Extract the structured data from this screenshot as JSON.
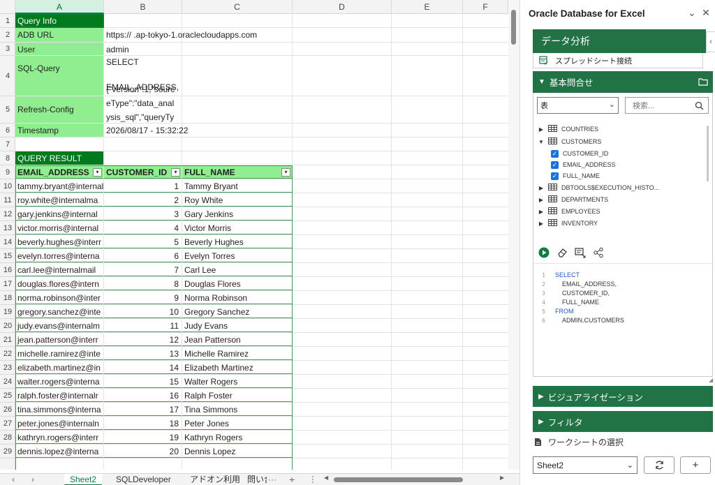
{
  "sheet": {
    "columns": [
      "A",
      "B",
      "C",
      "D",
      "E",
      "F"
    ],
    "rows": [
      "1",
      "2",
      "3",
      "4",
      "5",
      "6",
      "7",
      "8",
      "9",
      "10",
      "11",
      "12",
      "13",
      "14",
      "15",
      "16",
      "17",
      "18",
      "19",
      "20",
      "21",
      "22",
      "23",
      "24",
      "25",
      "26",
      "27",
      "28",
      "29"
    ],
    "info": {
      "title": "Query Info",
      "adb_url_label": "ADB URL",
      "adb_url_value": "https://                         .ap-tokyo-1.oraclecloudapps.com",
      "user_label": "User",
      "user_value": "admin",
      "sql_label": "SQL-Query",
      "sql_line1": "SELECT",
      "sql_line2": "EMAIL_ADDRESS,",
      "refresh_label": "Refresh-Config",
      "refresh_line1": "{\"version\":1,\"sourc",
      "refresh_line2": "eType\":\"data_anal",
      "refresh_line3": "ysis_sql\",\"queryTy",
      "timestamp_label": "Timestamp",
      "timestamp_value": "2026/08/17 - 15:32:22"
    },
    "result_title": "QUERY RESULT",
    "headers": [
      "EMAIL_ADDRESS",
      "CUSTOMER_ID",
      "FULL_NAME"
    ],
    "records": [
      {
        "email": "tammy.bryant@internal",
        "id": "1",
        "name": "Tammy Bryant"
      },
      {
        "email": "roy.white@internalma",
        "id": "2",
        "name": "Roy White"
      },
      {
        "email": "gary.jenkins@internal",
        "id": "3",
        "name": "Gary Jenkins"
      },
      {
        "email": "victor.morris@internal",
        "id": "4",
        "name": "Victor Morris"
      },
      {
        "email": "beverly.hughes@interr",
        "id": "5",
        "name": "Beverly Hughes"
      },
      {
        "email": "evelyn.torres@interna",
        "id": "6",
        "name": "Evelyn Torres"
      },
      {
        "email": "carl.lee@internalmail",
        "id": "7",
        "name": "Carl Lee"
      },
      {
        "email": "douglas.flores@intern",
        "id": "8",
        "name": "Douglas Flores"
      },
      {
        "email": "norma.robinson@inter",
        "id": "9",
        "name": "Norma Robinson"
      },
      {
        "email": "gregory.sanchez@inte",
        "id": "10",
        "name": "Gregory Sanchez"
      },
      {
        "email": "judy.evans@internalm",
        "id": "11",
        "name": "Judy Evans"
      },
      {
        "email": "jean.patterson@interr",
        "id": "12",
        "name": "Jean Patterson"
      },
      {
        "email": "michelle.ramirez@inte",
        "id": "13",
        "name": "Michelle Ramirez"
      },
      {
        "email": "elizabeth.martinez@in",
        "id": "14",
        "name": "Elizabeth Martinez"
      },
      {
        "email": "walter.rogers@interna",
        "id": "15",
        "name": "Walter Rogers"
      },
      {
        "email": "ralph.foster@internalr",
        "id": "16",
        "name": "Ralph Foster"
      },
      {
        "email": "tina.simmons@interna",
        "id": "17",
        "name": "Tina Simmons"
      },
      {
        "email": "peter.jones@internaln",
        "id": "18",
        "name": "Peter Jones"
      },
      {
        "email": "kathryn.rogers@interr",
        "id": "19",
        "name": "Kathryn Rogers"
      },
      {
        "email": "dennis.lopez@interna",
        "id": "20",
        "name": "Dennis Lopez"
      }
    ],
    "tabs": [
      "Sheet2",
      "SQLDeveloper",
      "アドオン利用",
      "問い合"
    ],
    "active_tab": "Sheet2",
    "tab_more": "···",
    "add_sheet": "+",
    "menu_dots": "⋮"
  },
  "pane": {
    "title": "Oracle Database for Excel",
    "section_analysis": "データ分析",
    "spreadsheet_connection": "スプレッドシート接続",
    "basic_query": "基本問合せ",
    "object_type": "表",
    "search_placeholder": "検索...",
    "tree": [
      {
        "label": "COUNTRIES",
        "expanded": false
      },
      {
        "label": "CUSTOMERS",
        "expanded": true
      },
      {
        "label": "CUSTOMER_ID",
        "checked": true
      },
      {
        "label": "EMAIL_ADDRESS",
        "checked": true
      },
      {
        "label": "FULL_NAME",
        "checked": true
      },
      {
        "label": "DBTOOLS$EXECUTION_HISTO...",
        "expanded": false
      },
      {
        "label": "DEPARTMENTS",
        "expanded": false
      },
      {
        "label": "EMPLOYEES",
        "expanded": false
      },
      {
        "label": "INVENTORY",
        "expanded": false
      }
    ],
    "sql_lines": [
      {
        "n": "1",
        "text": "SELECT",
        "kw": true
      },
      {
        "n": "2",
        "text": "EMAIL_ADDRESS,",
        "kw": false
      },
      {
        "n": "3",
        "text": "CUSTOMER_ID,",
        "kw": false
      },
      {
        "n": "4",
        "text": "FULL_NAME",
        "kw": false
      },
      {
        "n": "5",
        "text": "FROM",
        "kw": true
      },
      {
        "n": "6",
        "text": "ADMIN.CUSTOMERS",
        "kw": false
      }
    ],
    "visualization": "ビジュアライゼーション",
    "filter": "フィルタ",
    "worksheet_select": "ワークシートの選択",
    "selected_sheet": "Sheet2"
  },
  "colors": {
    "accent": "#217346",
    "info_green": "#90ee90",
    "header_dark_green": "#007a1c",
    "checkbox_blue": "#1a73d9"
  }
}
